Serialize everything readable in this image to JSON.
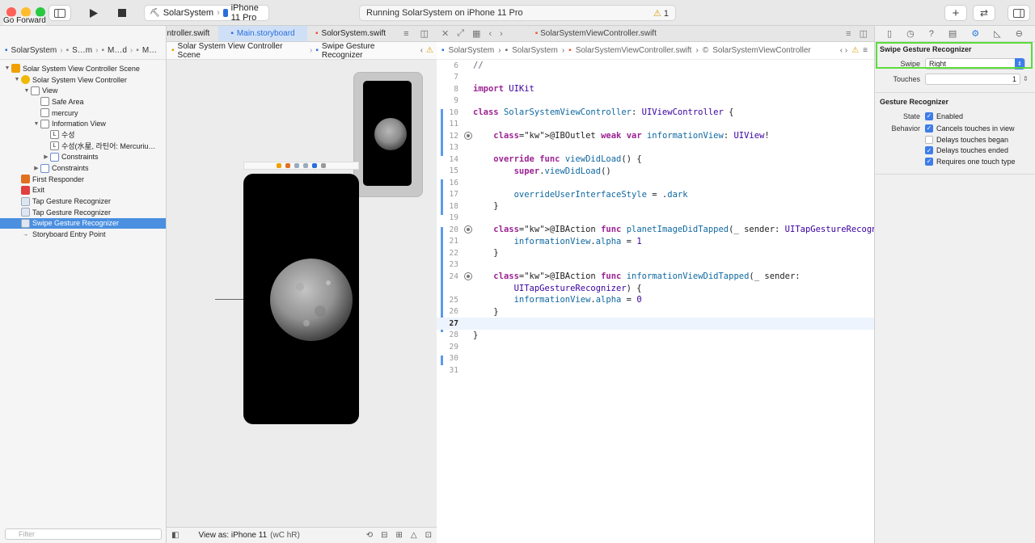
{
  "toolbar": {
    "scheme_project": "SolarSystem",
    "scheme_device": "iPhone 11 Pro",
    "status_text": "Running SolarSystem on iPhone 11 Pro",
    "warning_count": "1",
    "tooltip": "Go Forward"
  },
  "editor_tabs": [
    "SolarSystemV…ontroller.swift",
    "Main.storyboard",
    "SolorSystem.swift"
  ],
  "navigator": {
    "breadcrumb": [
      "SolarSystem",
      "S…m",
      "M…d",
      "M…"
    ],
    "items": [
      {
        "label": "Solar System View Controller Scene",
        "depth": 0,
        "disc": "▼",
        "icon": "scene-icon"
      },
      {
        "label": "Solar System View Controller",
        "depth": 1,
        "disc": "▼",
        "icon": "view-controller-icon"
      },
      {
        "label": "View",
        "depth": 2,
        "disc": "▼",
        "icon": "view-icon"
      },
      {
        "label": "Safe Area",
        "depth": 3,
        "disc": "",
        "icon": "view-icon"
      },
      {
        "label": "mercury",
        "depth": 3,
        "disc": "",
        "icon": "image-view-icon"
      },
      {
        "label": "Information View",
        "depth": 3,
        "disc": "▼",
        "icon": "view-icon"
      },
      {
        "label": "수성",
        "depth": 4,
        "disc": "",
        "icon": "label-icon"
      },
      {
        "label": "수성(水星, 라틴어: Mercuriu…",
        "depth": 4,
        "disc": "",
        "icon": "label-icon"
      },
      {
        "label": "Constraints",
        "depth": 4,
        "disc": "▶",
        "icon": "constraints-icon"
      },
      {
        "label": "Constraints",
        "depth": 3,
        "disc": "▶",
        "icon": "constraints-icon"
      },
      {
        "label": "First Responder",
        "depth": 1,
        "disc": "",
        "icon": "first-responder-icon"
      },
      {
        "label": "Exit",
        "depth": 1,
        "disc": "",
        "icon": "exit-icon"
      },
      {
        "label": "Tap Gesture Recognizer",
        "depth": 1,
        "disc": "",
        "icon": "gesture-icon"
      },
      {
        "label": "Tap Gesture Recognizer",
        "depth": 1,
        "disc": "",
        "icon": "gesture-icon"
      },
      {
        "label": "Swipe Gesture Recognizer",
        "depth": 1,
        "disc": "",
        "icon": "gesture-icon",
        "selected": true
      },
      {
        "label": "Storyboard Entry Point",
        "depth": 1,
        "disc": "",
        "icon": "arrow-icon"
      }
    ],
    "filter_placeholder": "Filter"
  },
  "canvas": {
    "breadcrumb": [
      "Solar System View Controller Scene",
      "Swipe Gesture Recognizer"
    ],
    "view_as": "View as: iPhone 11",
    "size_class": "(wC hR)"
  },
  "code_editor": {
    "tab": "SolarSystemViewController.swift",
    "breadcrumb": [
      "SolarSystem",
      "SolarSystem",
      "SolarSystemViewController.swift",
      "SolarSystemViewController"
    ],
    "lines": [
      {
        "n": "6",
        "text": "//"
      },
      {
        "n": "7",
        "text": ""
      },
      {
        "n": "8",
        "text": "import UIKit"
      },
      {
        "n": "9",
        "text": ""
      },
      {
        "n": "10",
        "text": "class SolarSystemViewController: UIViewController {"
      },
      {
        "n": "11",
        "text": ""
      },
      {
        "n": "12",
        "text": "    @IBOutlet weak var informationView: UIView!",
        "outlet": true
      },
      {
        "n": "13",
        "text": ""
      },
      {
        "n": "14",
        "text": "    override func viewDidLoad() {"
      },
      {
        "n": "15",
        "text": "        super.viewDidLoad()"
      },
      {
        "n": "16",
        "text": ""
      },
      {
        "n": "17",
        "text": "        overrideUserInterfaceStyle = .dark"
      },
      {
        "n": "18",
        "text": "    }"
      },
      {
        "n": "19",
        "text": ""
      },
      {
        "n": "20",
        "text": "    @IBAction func planetImageDidTapped(_ sender: UITapGestureRecognizer) {",
        "outlet": true
      },
      {
        "n": "21",
        "text": "        informationView.alpha = 1"
      },
      {
        "n": "22",
        "text": "    }"
      },
      {
        "n": "23",
        "text": ""
      },
      {
        "n": "24",
        "text": "    @IBAction func informationViewDidTapped(_ sender:",
        "outlet": true
      },
      {
        "n": "",
        "text": "        UITapGestureRecognizer) {"
      },
      {
        "n": "25",
        "text": "        informationView.alpha = 0"
      },
      {
        "n": "26",
        "text": "    }"
      },
      {
        "n": "27",
        "text": "",
        "current": true
      },
      {
        "n": "28",
        "text": "}"
      },
      {
        "n": "29",
        "text": ""
      },
      {
        "n": "30",
        "text": ""
      },
      {
        "n": "31",
        "text": ""
      }
    ]
  },
  "inspector": {
    "section1_title": "Swipe Gesture Recognizer",
    "swipe_label": "Swipe",
    "swipe_value": "Right",
    "touches_label": "Touches",
    "touches_value": "1",
    "section2_title": "Gesture Recognizer",
    "state_label": "State",
    "state_enabled": "Enabled",
    "behavior_label": "Behavior",
    "behaviors": [
      {
        "label": "Cancels touches in view",
        "checked": true
      },
      {
        "label": "Delays touches began",
        "checked": false
      },
      {
        "label": "Delays touches ended",
        "checked": true
      },
      {
        "label": "Requires one touch type",
        "checked": true
      }
    ]
  },
  "colors": {
    "accent": "#3d7de8",
    "selection": "#4a8fe0",
    "highlight_border": "#5cdc3c"
  }
}
